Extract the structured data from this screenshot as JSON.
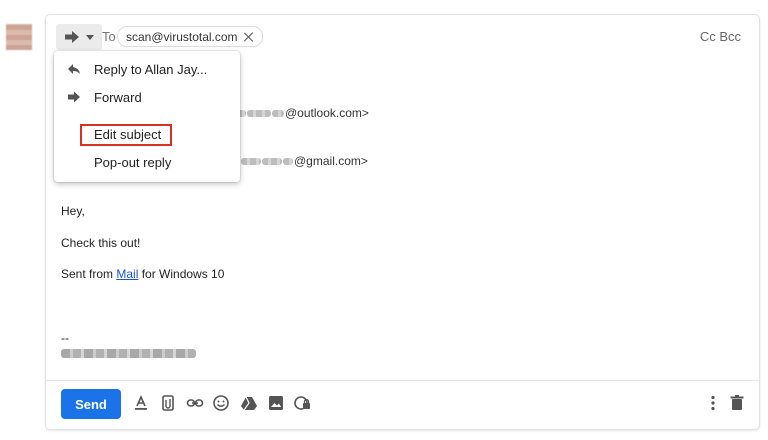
{
  "compose": {
    "to_label": "To",
    "recipient": "scan@virustotal.com",
    "cc_bcc": "Cc Bcc"
  },
  "quoted": {
    "line1_suffix": "@outlook.com>",
    "line2_suffix": "@gmail.com>"
  },
  "body": {
    "greeting": "Hey,",
    "line1": "Check this out!",
    "sent_from_prefix": "Sent from ",
    "sent_from_link": "Mail",
    "sent_from_suffix": " for Windows 10",
    "sig_dash": "--"
  },
  "menu": {
    "items": [
      {
        "label": "Reply to Allan Jay...",
        "icon": "reply-icon"
      },
      {
        "label": "Forward",
        "icon": "forward-icon"
      },
      {
        "label": "Edit subject",
        "icon": ""
      },
      {
        "label": "Pop-out reply",
        "icon": ""
      }
    ],
    "highlighted": "Edit subject",
    "highlight_color": "#d93025"
  },
  "toolbar": {
    "send_label": "Send",
    "send_color": "#1a73e8",
    "icons": [
      "text-format-icon",
      "attach-icon",
      "link-icon",
      "emoji-icon",
      "drive-icon",
      "photo-icon",
      "confidential-icon",
      "more-options-icon",
      "trash-icon"
    ]
  }
}
